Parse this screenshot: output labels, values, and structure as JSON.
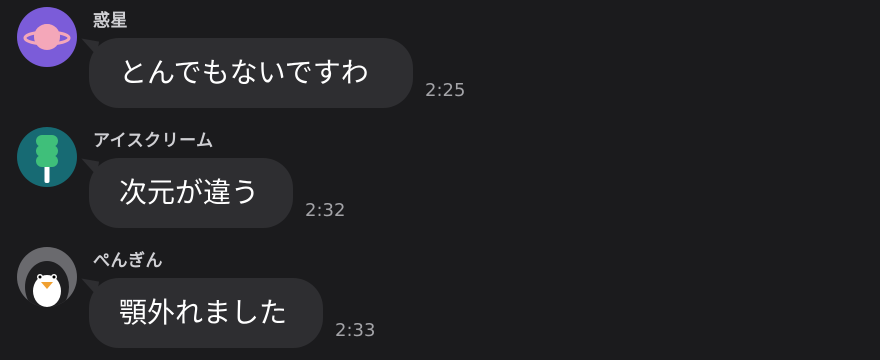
{
  "messages": [
    {
      "sender": "惑星",
      "avatar_icon": "planet-icon",
      "avatar_bg": "#7b5cd9",
      "text": "とんでもないですわ",
      "time": "2:25"
    },
    {
      "sender": "アイスクリーム",
      "avatar_icon": "popsicle-icon",
      "avatar_bg": "#176a73",
      "text": "次元が違う",
      "time": "2:32"
    },
    {
      "sender": "ぺんぎん",
      "avatar_icon": "penguin-icon",
      "avatar_bg": "#6a6a6e",
      "text": "顎外れました",
      "time": "2:33"
    }
  ]
}
